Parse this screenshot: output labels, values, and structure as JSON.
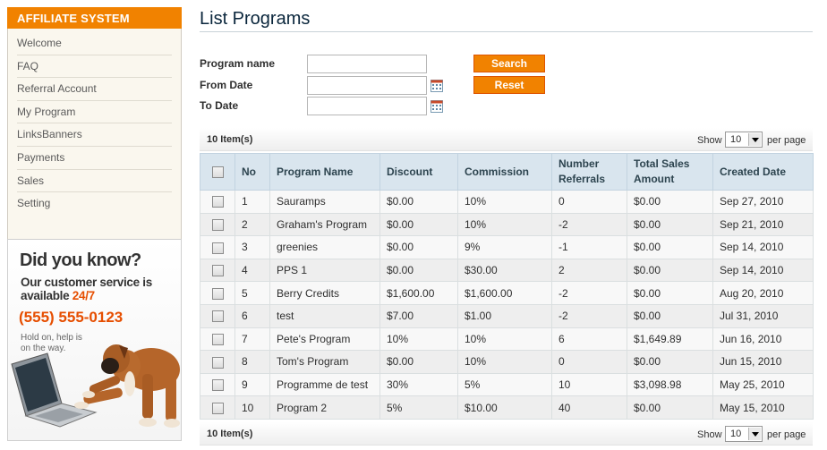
{
  "sidebar": {
    "title": "AFFILIATE SYSTEM",
    "items": [
      {
        "label": "Welcome"
      },
      {
        "label": "FAQ"
      },
      {
        "label": "Referral Account"
      },
      {
        "label": "My Program"
      },
      {
        "label": "LinksBanners"
      },
      {
        "label": "Payments"
      },
      {
        "label": "Sales"
      },
      {
        "label": "Setting"
      }
    ]
  },
  "promo": {
    "headline": "Did you know?",
    "line1": "Our customer service is",
    "line2_prefix": "available ",
    "line2_highlight": "24/7",
    "phone": "(555) 555-0123",
    "note": "Hold on, help is on the way."
  },
  "main": {
    "title": "List Programs",
    "filters": {
      "program_name_label": "Program name",
      "from_date_label": "From Date",
      "to_date_label": "To Date",
      "program_name_value": "",
      "from_date_value": "",
      "to_date_value": ""
    },
    "buttons": {
      "search": "Search",
      "reset": "Reset"
    },
    "pager": {
      "count": "10 Item(s)",
      "show": "Show",
      "per_page_value": "10",
      "per_page": "per page"
    },
    "table": {
      "headers": [
        "No",
        "Program Name",
        "Discount",
        "Commission",
        "Number Referrals",
        "Total Sales Amount",
        "Created Date"
      ],
      "rows": [
        [
          "1",
          "Sauramps",
          "$0.00",
          "10%",
          "0",
          "$0.00",
          "Sep 27, 2010"
        ],
        [
          "2",
          "Graham's Program",
          "$0.00",
          "10%",
          "-2",
          "$0.00",
          "Sep 21, 2010"
        ],
        [
          "3",
          "greenies",
          "$0.00",
          "9%",
          "-1",
          "$0.00",
          "Sep 14, 2010"
        ],
        [
          "4",
          "PPS 1",
          "$0.00",
          "$30.00",
          "2",
          "$0.00",
          "Sep 14, 2010"
        ],
        [
          "5",
          "Berry Credits",
          "$1,600.00",
          "$1,600.00",
          "-2",
          "$0.00",
          "Aug 20, 2010"
        ],
        [
          "6",
          "test",
          "$7.00",
          "$1.00",
          "-2",
          "$0.00",
          "Jul 31, 2010"
        ],
        [
          "7",
          "Pete's Program",
          "10%",
          "10%",
          "6",
          "$1,649.89",
          "Jun 16, 2010"
        ],
        [
          "8",
          "Tom's Program",
          "$0.00",
          "10%",
          "0",
          "$0.00",
          "Jun 15, 2010"
        ],
        [
          "9",
          "Programme de test",
          "30%",
          "5%",
          "10",
          "$3,098.98",
          "May 25, 2010"
        ],
        [
          "10",
          "Program 2",
          "5%",
          "$10.00",
          "40",
          "$0.00",
          "May 15, 2010"
        ]
      ]
    }
  },
  "colors": {
    "accent": "#f18200",
    "header_bg": "#d9e5ee",
    "title": "#0a263c"
  }
}
